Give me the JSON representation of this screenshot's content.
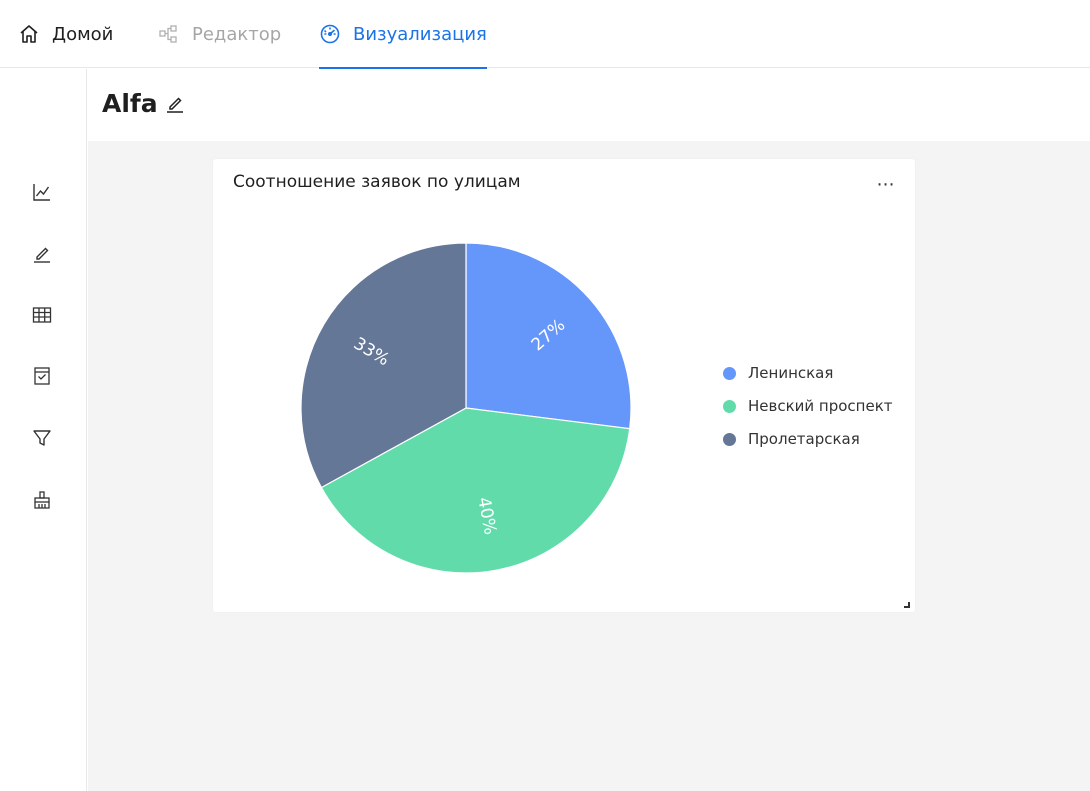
{
  "nav": {
    "tabs": [
      {
        "label": "Домой",
        "icon": "home-icon"
      },
      {
        "label": "Редактор",
        "icon": "flow-icon"
      },
      {
        "label": "Визуализация",
        "icon": "dashboard-gauge-icon"
      }
    ],
    "active_tab": 2,
    "accent": "#1a73e8"
  },
  "sidebar": {
    "items": [
      {
        "icon": "line-chart-icon"
      },
      {
        "icon": "pencil-icon"
      },
      {
        "icon": "table-icon"
      },
      {
        "icon": "report-icon"
      },
      {
        "icon": "filter-icon"
      },
      {
        "icon": "brush-icon"
      }
    ]
  },
  "page": {
    "title": "Alfa"
  },
  "card": {
    "title": "Соотношение заявок по улицам",
    "menu_label": "⋯"
  },
  "chart_data": {
    "type": "pie",
    "title": "Соотношение заявок по улицам",
    "legend_position": "right",
    "slices": [
      {
        "name": "Ленинская",
        "value": 27,
        "label": "27%",
        "color": "#6596fa"
      },
      {
        "name": "Невский проспект",
        "value": 40,
        "label": "40%",
        "color": "#62dbab"
      },
      {
        "name": "Пролетарская",
        "value": 33,
        "label": "33%",
        "color": "#657797"
      }
    ]
  }
}
